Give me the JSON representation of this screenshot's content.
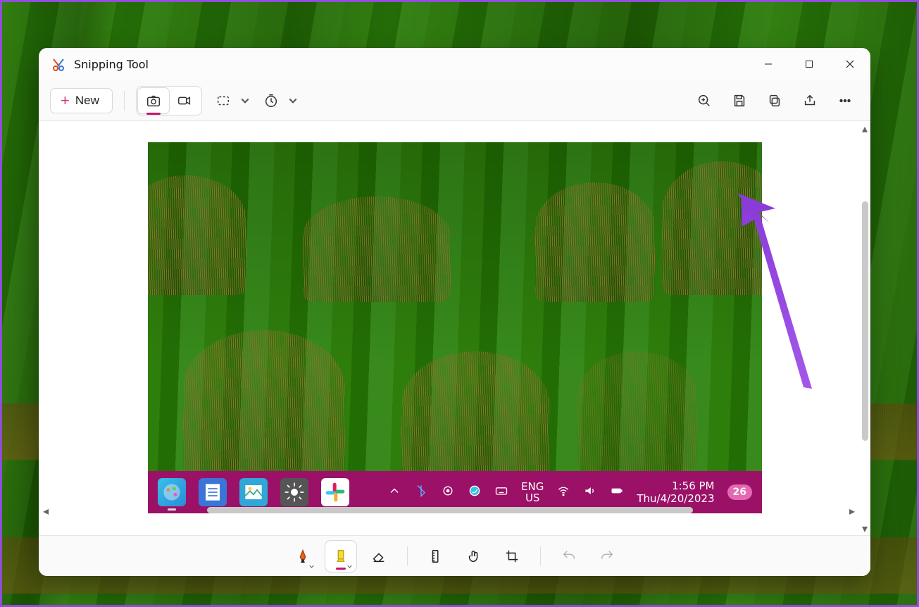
{
  "app": {
    "title": "Snipping Tool"
  },
  "toolbar": {
    "new_label": "New"
  },
  "captured_taskbar": {
    "lang_primary": "ENG",
    "lang_secondary": "US",
    "time": "1:56 PM",
    "date": "Thu/4/20/2023",
    "notification_count": "26"
  },
  "colors": {
    "accent": "#c5156c",
    "annotation": "#8a3bd8",
    "taskbar": "#9b1168"
  }
}
